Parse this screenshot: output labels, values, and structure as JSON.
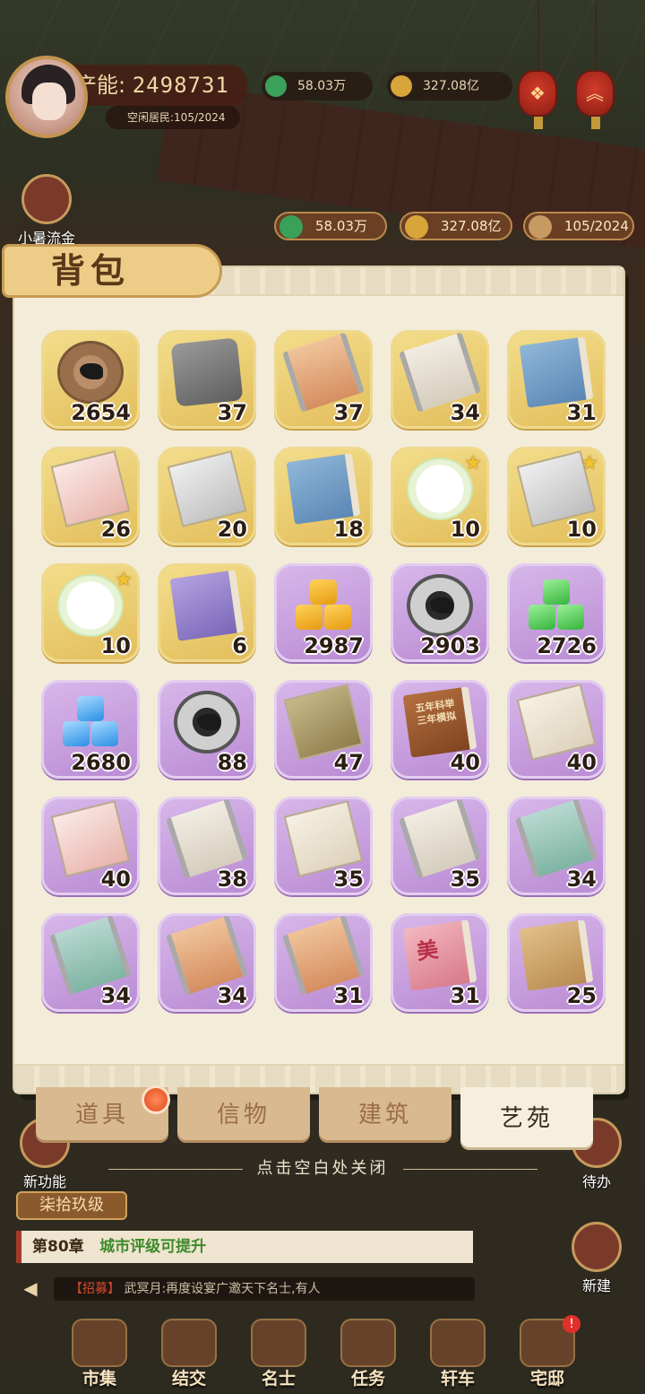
{
  "hud": {
    "power_label": "产能:",
    "power_value": "2498731",
    "idle_residents": "空闲居民:105/2024",
    "silver_top": "58.03万",
    "gold_top": "327.08亿",
    "lantern_left": "❖",
    "lantern_right": "︽"
  },
  "side": {
    "event_label": "小暑流金",
    "new_feature_label": "新功能",
    "todo_label": "待办",
    "build_label": "新建"
  },
  "resources": {
    "silver": "58.03万",
    "gold": "327.08亿",
    "residents": "105/2024"
  },
  "colors": {
    "gold_slot": "#e9c96a",
    "purple_slot": "#c49bdc",
    "accent": "#a23a2a"
  },
  "backpack": {
    "title": "背包",
    "items": [
      {
        "qty": "2654",
        "rarity": "gold",
        "art": "a-coin",
        "star": false
      },
      {
        "qty": "37",
        "rarity": "gold",
        "art": "a-stone",
        "star": false
      },
      {
        "qty": "37",
        "rarity": "gold",
        "art": "a-scroll warm",
        "star": false
      },
      {
        "qty": "34",
        "rarity": "gold",
        "art": "a-scroll pale",
        "star": false
      },
      {
        "qty": "31",
        "rarity": "gold",
        "art": "a-book",
        "star": false
      },
      {
        "qty": "26",
        "rarity": "gold",
        "art": "a-paper red",
        "star": false
      },
      {
        "qty": "20",
        "rarity": "gold",
        "art": "a-paper gray",
        "star": false
      },
      {
        "qty": "18",
        "rarity": "gold",
        "art": "a-book",
        "star": false
      },
      {
        "qty": "10",
        "rarity": "gold",
        "art": "a-bubble",
        "star": true
      },
      {
        "qty": "10",
        "rarity": "gold",
        "art": "a-paper gray",
        "star": true
      },
      {
        "qty": "10",
        "rarity": "gold",
        "art": "a-bubble",
        "star": true
      },
      {
        "qty": "6",
        "rarity": "gold",
        "art": "a-book purple",
        "star": false
      },
      {
        "qty": "2987",
        "rarity": "purple",
        "art": "a-cubes yellow",
        "star": false
      },
      {
        "qty": "2903",
        "rarity": "purple",
        "art": "a-coin black",
        "star": false
      },
      {
        "qty": "2726",
        "rarity": "purple",
        "art": "a-cubes green",
        "star": false
      },
      {
        "qty": "2680",
        "rarity": "purple",
        "art": "a-cubes blue",
        "star": false
      },
      {
        "qty": "88",
        "rarity": "purple",
        "art": "a-coin black",
        "star": false
      },
      {
        "qty": "47",
        "rarity": "purple",
        "art": "a-paper olive",
        "star": false
      },
      {
        "qty": "40",
        "rarity": "purple",
        "art": "a-book brown",
        "star": false
      },
      {
        "qty": "40",
        "rarity": "purple",
        "art": "a-paper",
        "star": false
      },
      {
        "qty": "40",
        "rarity": "purple",
        "art": "a-paper red",
        "star": false
      },
      {
        "qty": "38",
        "rarity": "purple",
        "art": "a-scroll pale",
        "star": false
      },
      {
        "qty": "35",
        "rarity": "purple",
        "art": "a-paper",
        "star": false
      },
      {
        "qty": "35",
        "rarity": "purple",
        "art": "a-scroll pale",
        "star": false
      },
      {
        "qty": "34",
        "rarity": "purple",
        "art": "a-scroll green",
        "star": false
      },
      {
        "qty": "34",
        "rarity": "purple",
        "art": "a-scroll green",
        "star": false
      },
      {
        "qty": "34",
        "rarity": "purple",
        "art": "a-scroll warm",
        "star": false
      },
      {
        "qty": "31",
        "rarity": "purple",
        "art": "a-scroll warm",
        "star": false
      },
      {
        "qty": "31",
        "rarity": "purple",
        "art": "a-book pink",
        "star": false
      },
      {
        "qty": "25",
        "rarity": "purple",
        "art": "a-book tan",
        "star": false
      }
    ],
    "book_text_1": "五年科举",
    "book_text_2": "三年模拟",
    "pink_book_char": "美"
  },
  "tabs": [
    {
      "label": "道具",
      "active": false
    },
    {
      "label": "信物",
      "active": false
    },
    {
      "label": "建筑",
      "active": false
    },
    {
      "label": "艺苑",
      "active": true
    }
  ],
  "close_hint": "点击空白处关闭",
  "progress": {
    "level": "柒拾玖级",
    "chapter": "第80章",
    "chapter_status": "城市评级可提升"
  },
  "news": {
    "tag": "【招募】",
    "text": "武冥月:再度设宴广邀天下名士,有人"
  },
  "nav": [
    {
      "label": "市集",
      "badge": ""
    },
    {
      "label": "结交",
      "badge": ""
    },
    {
      "label": "名士",
      "badge": ""
    },
    {
      "label": "任务",
      "badge": ""
    },
    {
      "label": "轩车",
      "badge": ""
    },
    {
      "label": "宅邸",
      "badge": "!"
    }
  ]
}
